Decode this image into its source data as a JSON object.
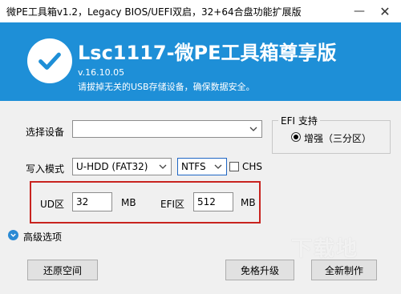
{
  "window": {
    "title": "微PE工具箱v1.2，Legacy BIOS/UEFI双启，32+64合盘功能扩展版",
    "minimize_icon": "minimize-icon",
    "close_icon": "close-icon"
  },
  "header": {
    "brand": "Lsc1117-微PE工具箱尊享版",
    "version": "v.16.10.05",
    "warning": "请拔掉无关的USB存储设备，确保数据安全。",
    "bg_color": "#1e8fd7"
  },
  "form": {
    "device_label": "选择设备",
    "device_value": "",
    "mode_label": "写入模式",
    "mode_value": "U-HDD (FAT32)",
    "fs_value": "NTFS",
    "chs_label": "CHS",
    "chs_checked": false,
    "ud_label": "UD区",
    "ud_value": "32",
    "ud_unit": "MB",
    "efi_label": "EFI区",
    "efi_value": "512",
    "efi_unit": "MB",
    "highlight_color": "#c8231f"
  },
  "efi_support": {
    "legend": "EFI 支持",
    "option_label": "增强（三分区）",
    "selected": true
  },
  "advanced": {
    "label": "高级选项"
  },
  "buttons": {
    "restore": "还原空间",
    "upgrade": "免格升级",
    "install": "全新制作"
  },
  "watermark": {
    "text": "下载地"
  }
}
